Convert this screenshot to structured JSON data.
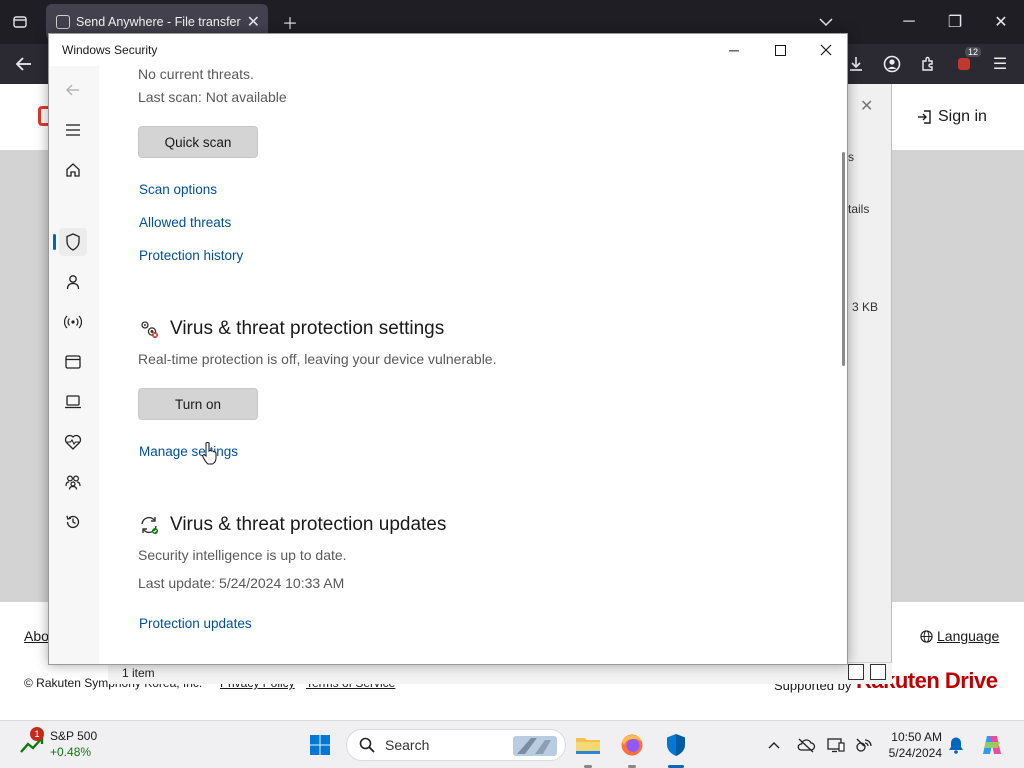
{
  "browser": {
    "tab_title": "Send Anywhere - File transfer",
    "notifications_badge": "12"
  },
  "website": {
    "sign_in": "Sign in",
    "about_link": "Abo",
    "language_link": "Language",
    "copyright": "© Rakuten Symphony Korea, Inc.",
    "privacy_policy": "Privacy Policy",
    "terms": "Terms of Service",
    "supported_by": "Supported by",
    "brand": "Rakuten Drive"
  },
  "file_dialog": {
    "fragment_1": "s",
    "fragment_2": "tails",
    "fragment_3": "3 KB",
    "status": "1 item"
  },
  "security_window": {
    "title": "Windows Security",
    "no_threats": "No current threats.",
    "last_scan": "Last scan: Not available",
    "quick_scan": "Quick scan",
    "scan_options": "Scan options",
    "allowed_threats": "Allowed threats",
    "protection_history": "Protection history",
    "settings_heading": "Virus & threat protection settings",
    "settings_desc": "Real-time protection is off, leaving your device vulnerable.",
    "turn_on": "Turn on",
    "manage_settings": "Manage settings",
    "updates_heading": "Virus & threat protection updates",
    "updates_desc": "Security intelligence is up to date.",
    "last_update": "Last update: 5/24/2024 10:33 AM",
    "protection_updates": "Protection updates"
  },
  "taskbar": {
    "stock_name": "S&P 500",
    "stock_change": "+0.48%",
    "stock_badge": "1",
    "search_placeholder": "Search",
    "time": "10:50 AM",
    "date": "5/24/2024"
  },
  "colors": {
    "link": "#004f9e",
    "accent": "#0067c0",
    "brand_red": "#bf0000"
  }
}
